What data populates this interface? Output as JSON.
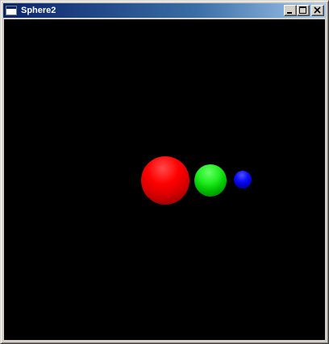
{
  "window": {
    "title": "Sphere2",
    "buttons": {
      "minimize": "minimize-icon",
      "maximize": "maximize-icon",
      "close": "close-icon"
    }
  },
  "scene": {
    "background": "#000000",
    "spheres": [
      {
        "name": "red-sphere",
        "color": "#ff0000"
      },
      {
        "name": "green-sphere",
        "color": "#00cc00"
      },
      {
        "name": "blue-sphere",
        "color": "#0000ff"
      }
    ]
  },
  "colors": {
    "titlebar_start": "#0a246a",
    "titlebar_end": "#a6caf0",
    "chrome": "#d4d0c8"
  }
}
